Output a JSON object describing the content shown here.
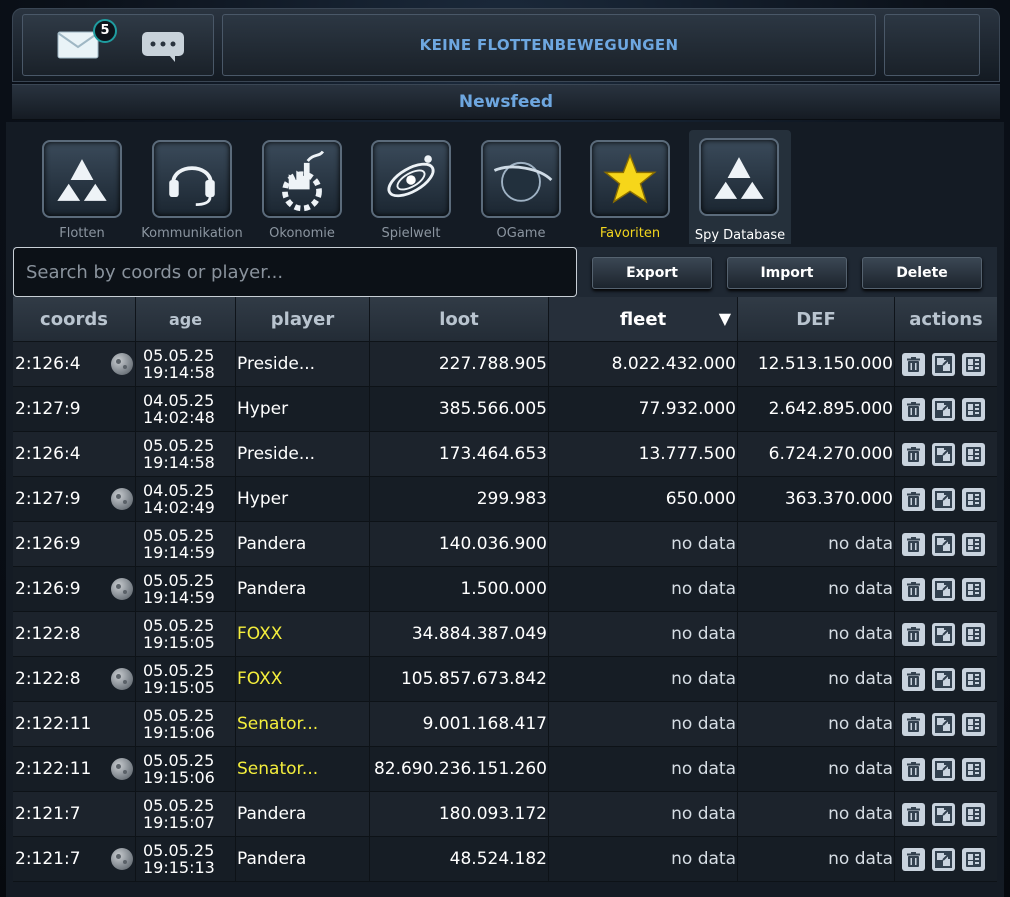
{
  "topbar": {
    "mail_badge": "5",
    "fleet_status": "KEINE FLOTTENBEWEGUNGEN"
  },
  "newsfeed": {
    "title": "Newsfeed"
  },
  "tabs": [
    {
      "label": "Flotten",
      "icon": "fleet-icon"
    },
    {
      "label": "Kommunikation",
      "icon": "headset-icon"
    },
    {
      "label": "Okonomie",
      "icon": "factory-icon"
    },
    {
      "label": "Spielwelt",
      "icon": "galaxy-icon"
    },
    {
      "label": "OGame",
      "icon": "planet-icon"
    },
    {
      "label": "Favoriten",
      "icon": "star-icon"
    },
    {
      "label": "Spy Database",
      "icon": "spy-icon",
      "active": true
    }
  ],
  "toolbar": {
    "search_placeholder": "Search by coords or player...",
    "export_label": "Export",
    "import_label": "Import",
    "delete_label": "Delete"
  },
  "table": {
    "columns": [
      "coords",
      "age",
      "player",
      "loot",
      "fleet",
      "DEF",
      "actions"
    ],
    "sorted_column": "fleet",
    "sort_direction": "desc",
    "rows": [
      {
        "coords": "2:126:4",
        "moon": true,
        "date": "05.05.25",
        "time": "19:14:58",
        "player": "Preside...",
        "player_color": "white",
        "loot": "227.788.905",
        "fleet": "8.022.432.000",
        "def": "12.513.150.000"
      },
      {
        "coords": "2:127:9",
        "moon": false,
        "date": "04.05.25",
        "time": "14:02:48",
        "player": "Hyper",
        "player_color": "white",
        "loot": "385.566.005",
        "fleet": "77.932.000",
        "def": "2.642.895.000"
      },
      {
        "coords": "2:126:4",
        "moon": false,
        "date": "05.05.25",
        "time": "19:14:58",
        "player": "Preside...",
        "player_color": "white",
        "loot": "173.464.653",
        "fleet": "13.777.500",
        "def": "6.724.270.000"
      },
      {
        "coords": "2:127:9",
        "moon": true,
        "date": "04.05.25",
        "time": "14:02:49",
        "player": "Hyper",
        "player_color": "white",
        "loot": "299.983",
        "fleet": "650.000",
        "def": "363.370.000"
      },
      {
        "coords": "2:126:9",
        "moon": false,
        "date": "05.05.25",
        "time": "19:14:59",
        "player": "Pandera",
        "player_color": "white",
        "loot": "140.036.900",
        "fleet": "no data",
        "def": "no data"
      },
      {
        "coords": "2:126:9",
        "moon": true,
        "date": "05.05.25",
        "time": "19:14:59",
        "player": "Pandera",
        "player_color": "white",
        "loot": "1.500.000",
        "fleet": "no data",
        "def": "no data"
      },
      {
        "coords": "2:122:8",
        "moon": false,
        "date": "05.05.25",
        "time": "19:15:05",
        "player": "FOXX",
        "player_color": "yellow",
        "loot": "34.884.387.049",
        "fleet": "no data",
        "def": "no data"
      },
      {
        "coords": "2:122:8",
        "moon": true,
        "date": "05.05.25",
        "time": "19:15:05",
        "player": "FOXX",
        "player_color": "yellow",
        "loot": "105.857.673.842",
        "fleet": "no data",
        "def": "no data"
      },
      {
        "coords": "2:122:11",
        "moon": false,
        "date": "05.05.25",
        "time": "19:15:06",
        "player": "Senator...",
        "player_color": "yellow",
        "loot": "9.001.168.417",
        "fleet": "no data",
        "def": "no data"
      },
      {
        "coords": "2:122:11",
        "moon": true,
        "date": "05.05.25",
        "time": "19:15:06",
        "player": "Senator...",
        "player_color": "yellow",
        "loot": "82.690.236.151.260",
        "fleet": "no data",
        "def": "no data"
      },
      {
        "coords": "2:121:7",
        "moon": false,
        "date": "05.05.25",
        "time": "19:15:07",
        "player": "Pandera",
        "player_color": "white",
        "loot": "180.093.172",
        "fleet": "no data",
        "def": "no data"
      },
      {
        "coords": "2:121:7",
        "moon": true,
        "date": "05.05.25",
        "time": "19:15:13",
        "player": "Pandera",
        "player_color": "white",
        "loot": "48.524.182",
        "fleet": "no data",
        "def": "no data"
      }
    ]
  },
  "colors": {
    "accent_blue": "#6ea7e0",
    "favorite_yellow": "#f2d51e",
    "player_yellow": "#f4ee3c"
  }
}
